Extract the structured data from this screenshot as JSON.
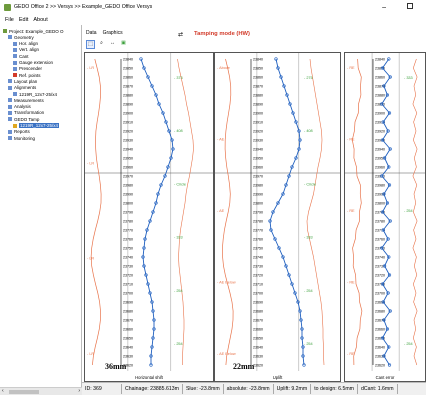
{
  "window": {
    "title": "GEDO Office 2  >> Versys >> Example_GEDO Office Versys",
    "minimize": "–"
  },
  "menu": [
    "File",
    "Edit",
    "About"
  ],
  "tree": {
    "nodes": [
      {
        "label": "Project: Example_GEDO O",
        "indent": 0,
        "color": "#6d9a3c"
      },
      {
        "label": "Geometry",
        "indent": 1,
        "color": "#6a8fd0"
      },
      {
        "label": "Hor. align",
        "indent": 2,
        "color": "#6a8fd0"
      },
      {
        "label": "Vert. align",
        "indent": 2,
        "color": "#6a8fd0"
      },
      {
        "label": "Cant",
        "indent": 2,
        "color": "#6a8fd0"
      },
      {
        "label": "Gauge extension",
        "indent": 2,
        "color": "#6a8fd0"
      },
      {
        "label": "Prescender",
        "indent": 2,
        "color": "#6a8fd0"
      },
      {
        "label": "Ref. points",
        "indent": 2,
        "color": "#d23b2a"
      },
      {
        "label": "Layout plan",
        "indent": 1,
        "color": "#6a8fd0"
      },
      {
        "label": "Alignments",
        "indent": 1,
        "color": "#6a8fd0"
      },
      {
        "label": "1219R_12x7-25/x4",
        "indent": 2,
        "color": "#6a8fd0"
      },
      {
        "label": "Measurements",
        "indent": 1,
        "color": "#6a8fd0"
      },
      {
        "label": "Analysis",
        "indent": 1,
        "color": "#6a8fd0"
      },
      {
        "label": "Transformation",
        "indent": 1,
        "color": "#6a8fd0"
      },
      {
        "label": "GEDO Tamp",
        "indent": 1,
        "color": "#6a8fd0"
      },
      {
        "label": "1219R_12x7-25/x4",
        "indent": 2,
        "color": "#e0a820",
        "selected": true
      },
      {
        "label": "Reports",
        "indent": 1,
        "color": "#6a8fd0"
      },
      {
        "label": "Monitoring",
        "indent": 1,
        "color": "#6a8fd0"
      }
    ]
  },
  "tabs": [
    "Data",
    "Graphics"
  ],
  "tamping_mode": "Tamping mode (HW)",
  "panels": [
    {
      "name": "Horizontal shift",
      "scale": "36mm",
      "left_labels": [
        "- LR",
        "- LR",
        "- LR",
        "- LR"
      ],
      "right_labels": [
        "- 373",
        "- 408",
        "- Circle",
        "- 333",
        "- 254",
        "- 254"
      ],
      "chainages": [
        "23840",
        "23850",
        "23860",
        "23870",
        "23880",
        "23890",
        "23900",
        "23910",
        "23920",
        "23930",
        "23940",
        "23950",
        "23960",
        "23970",
        "23980",
        "23990",
        "23800",
        "23790",
        "23780",
        "23770",
        "23760",
        "23750",
        "23740",
        "23730",
        "23720",
        "23710",
        "23700",
        "23690",
        "23680",
        "23670",
        "23660",
        "23650",
        "23640",
        "23630",
        "23620"
      ],
      "shift_mm": [
        -1.5,
        -1.2,
        -0.8,
        -0.4,
        0,
        0.3,
        0.7,
        1.0,
        1.3,
        1.6,
        1.7,
        1.5,
        1.2,
        0.9,
        0.5,
        0.2,
        0,
        -0.3,
        -0.6,
        -0.9,
        -1.1,
        -1.2,
        -1.3,
        -1.2,
        -1.0,
        -0.8,
        -0.6,
        -0.4,
        -0.3,
        -0.2,
        -0.2,
        -0.3,
        -0.4,
        -0.5,
        -0.5
      ]
    },
    {
      "name": "Uplift",
      "scale": "22mm",
      "left_labels": [
        "- Above",
        "- AE",
        "- AE",
        "- AE Below",
        "- AE Below"
      ],
      "right_labels": [
        "- 275",
        "- 408",
        "- Circle",
        "- 333",
        "- 254",
        "- 254"
      ],
      "chainages": [
        "23840",
        "23850",
        "23860",
        "23870",
        "23880",
        "23890",
        "23900",
        "23910",
        "23920",
        "23930",
        "23940",
        "23950",
        "23960",
        "23970",
        "23980",
        "23990",
        "23800",
        "23790",
        "23780",
        "23770",
        "23760",
        "23750",
        "23740",
        "23730",
        "23720",
        "23710",
        "23700",
        "23690",
        "23680",
        "23670",
        "23660",
        "23650",
        "23640",
        "23630",
        "23620"
      ],
      "uplift_mm": [
        -1.0,
        -0.8,
        -0.5,
        -0.2,
        0.1,
        0.4,
        0.7,
        1.0,
        1.3,
        1.4,
        1.3,
        1.0,
        0.6,
        0.3,
        0,
        -0.3,
        -0.8,
        -1.3,
        -1.6,
        -1.5,
        -1.1,
        -0.7,
        -0.3,
        0,
        0.3,
        0.6,
        0.9,
        1.2,
        1.4,
        1.5,
        1.6,
        1.6,
        1.7,
        1.7,
        1.8
      ]
    },
    {
      "name": "Cant error",
      "scale": "",
      "left_labels": [
        "- RE",
        "- RE",
        "- RE",
        "- RE",
        "- RE"
      ],
      "right_labels": [
        "- 333",
        "- 254",
        "- 254"
      ],
      "chainages": [
        "23840",
        "23850",
        "23860",
        "23870",
        "23880",
        "23890",
        "23900",
        "23910",
        "23920",
        "23930",
        "23940",
        "23950",
        "23960",
        "23970",
        "23980",
        "23990",
        "23800",
        "23790",
        "23780",
        "23770",
        "23760",
        "23750",
        "23740",
        "23730",
        "23720",
        "23710",
        "23700",
        "23690",
        "23680",
        "23670",
        "23660",
        "23650",
        "23640",
        "23630",
        "23620"
      ],
      "cant_mm": [
        0.4,
        -0.5,
        0.6,
        -0.3,
        0.2,
        -0.6,
        0.5,
        -0.4,
        0.3,
        -0.5,
        0.6,
        -0.2,
        0.4,
        -0.6,
        0.5,
        -0.3,
        0.2,
        -0.5,
        0.6,
        -0.4,
        0.3,
        -0.6,
        0.4,
        -0.2,
        0.5,
        -0.5,
        0.3,
        -0.4,
        0.6,
        -0.3,
        0.2,
        -0.5,
        0.4,
        -0.3,
        0.5
      ]
    }
  ],
  "status": {
    "id": "ID: 369",
    "chainage": "Chainage: 23885.613m",
    "slue": "Slue: -23.8mm",
    "absolute": "absolute: -23.8mm",
    "uplift": "Uplift: 9.2mm",
    "to_design": "to design: 6.5mm",
    "dcant": "dCant: 1.6mm"
  },
  "colors": {
    "accent_red": "#d23b2a",
    "blue_curve": "#1f5fbf",
    "orange_curve": "#e8734a",
    "green_curve": "#3ca03c"
  }
}
